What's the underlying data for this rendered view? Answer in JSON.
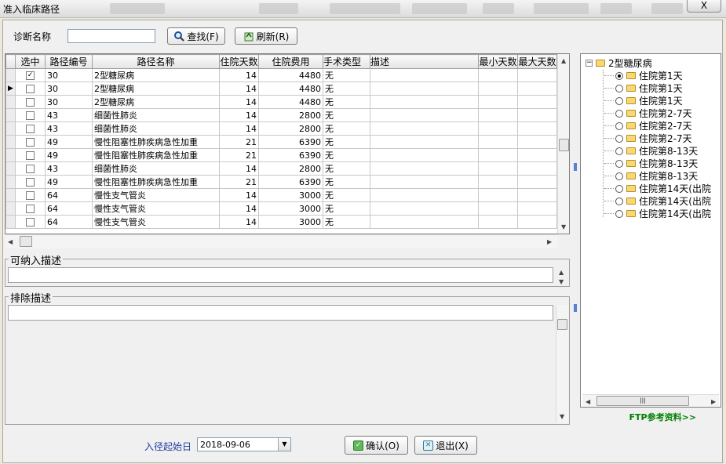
{
  "window": {
    "title": "准入临床路径",
    "close": "X"
  },
  "toolbar": {
    "diagnosis_label": "诊断名称",
    "diagnosis_value": "",
    "find_label": "查找(F)",
    "refresh_label": "刷新(R)"
  },
  "grid": {
    "columns": [
      "选中",
      "路径编号",
      "路径名称",
      "住院天数",
      "住院费用",
      "手术类型",
      "描述",
      "最小天数",
      "最大天数"
    ],
    "rows": [
      {
        "checked": true,
        "current": false,
        "id": "30",
        "name": "2型糖尿病",
        "days": "14",
        "fee": "4480",
        "surgery": "无"
      },
      {
        "checked": false,
        "current": true,
        "id": "30",
        "name": "2型糖尿病",
        "days": "14",
        "fee": "4480",
        "surgery": "无"
      },
      {
        "checked": false,
        "current": false,
        "id": "30",
        "name": "2型糖尿病",
        "days": "14",
        "fee": "4480",
        "surgery": "无"
      },
      {
        "checked": false,
        "current": false,
        "id": "43",
        "name": "细菌性肺炎",
        "days": "14",
        "fee": "2800",
        "surgery": "无"
      },
      {
        "checked": false,
        "current": false,
        "id": "43",
        "name": "细菌性肺炎",
        "days": "14",
        "fee": "2800",
        "surgery": "无"
      },
      {
        "checked": false,
        "current": false,
        "id": "49",
        "name": "慢性阻塞性肺疾病急性加重",
        "days": "21",
        "fee": "6390",
        "surgery": "无"
      },
      {
        "checked": false,
        "current": false,
        "id": "49",
        "name": "慢性阻塞性肺疾病急性加重",
        "days": "21",
        "fee": "6390",
        "surgery": "无"
      },
      {
        "checked": false,
        "current": false,
        "id": "43",
        "name": "细菌性肺炎",
        "days": "14",
        "fee": "2800",
        "surgery": "无"
      },
      {
        "checked": false,
        "current": false,
        "id": "49",
        "name": "慢性阻塞性肺疾病急性加重",
        "days": "21",
        "fee": "6390",
        "surgery": "无"
      },
      {
        "checked": false,
        "current": false,
        "id": "64",
        "name": "慢性支气管炎",
        "days": "14",
        "fee": "3000",
        "surgery": "无"
      },
      {
        "checked": false,
        "current": false,
        "id": "64",
        "name": "慢性支气管炎",
        "days": "14",
        "fee": "3000",
        "surgery": "无"
      },
      {
        "checked": false,
        "current": false,
        "id": "64",
        "name": "慢性支气管炎",
        "days": "14",
        "fee": "3000",
        "surgery": "无"
      }
    ]
  },
  "panels": {
    "include_title": "可纳入描述",
    "exclude_title": "排除描述"
  },
  "tree": {
    "root": "2型糖尿病",
    "items": [
      {
        "label": "住院第1天",
        "selected": true
      },
      {
        "label": "住院第1天",
        "selected": false
      },
      {
        "label": "住院第1天",
        "selected": false
      },
      {
        "label": "住院第2-7天",
        "selected": false
      },
      {
        "label": "住院第2-7天",
        "selected": false
      },
      {
        "label": "住院第2-7天",
        "selected": false
      },
      {
        "label": "住院第8-13天",
        "selected": false
      },
      {
        "label": "住院第8-13天",
        "selected": false
      },
      {
        "label": "住院第8-13天",
        "selected": false
      },
      {
        "label": "住院第14天(出院",
        "selected": false
      },
      {
        "label": "住院第14天(出院",
        "selected": false
      },
      {
        "label": "住院第14天(出院",
        "selected": false
      }
    ],
    "ftp_link": "FTP参考资料>>",
    "hscroll_grip": "|||"
  },
  "bottom": {
    "start_date_label": "入径起始日",
    "start_date_value": "2018-09-06",
    "confirm_label": "确认(O)",
    "exit_label": "退出(X)"
  },
  "colors": {
    "frame": "#ece9d8",
    "link": "#008000",
    "date_label": "#1f3fa0"
  }
}
